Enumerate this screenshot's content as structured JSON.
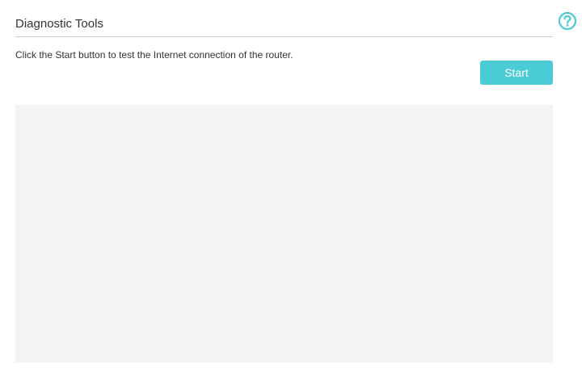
{
  "header": {
    "title": "Diagnostic Tools"
  },
  "main": {
    "description": "Click the Start button to test the Internet connection of the router.",
    "start_label": "Start",
    "output_text": ""
  },
  "icons": {
    "help": "help-circle-icon"
  },
  "colors": {
    "accent": "#4acbd6",
    "output_background": "#f3f3f3",
    "text": "#333333"
  }
}
